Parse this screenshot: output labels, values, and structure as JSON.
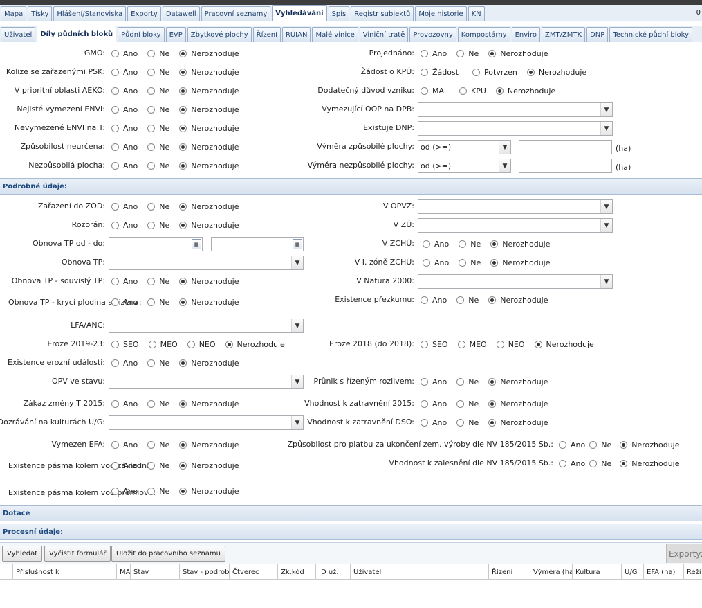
{
  "main_tabs": [
    "Mapa",
    "Tisky",
    "Hlášení/Stanoviska",
    "Exporty",
    "Datawell",
    "Pracovní seznamy",
    "Vyhledávání",
    "Spis",
    "Registr subjektů",
    "Moje historie",
    "KN"
  ],
  "main_tab_active": 6,
  "top_right_value": "0",
  "sub_tabs": [
    "Uživatel",
    "Díly půdních bloků",
    "Půdní bloky",
    "EVP",
    "Zbytkové plochy",
    "Řízení",
    "RÚIAN",
    "Malé vinice",
    "Viniční tratě",
    "Provozovny",
    "Kompostárny",
    "Enviro",
    "ZMT/ZMTK",
    "DNP",
    "Technické půdní bloky"
  ],
  "sub_tab_active": 1,
  "opt": {
    "ano": "Ano",
    "ne": "Ne",
    "nerozhoduje": "Nerozhoduje",
    "zadost": "Žádost",
    "potvrzen": "Potvrzen",
    "ma": "MA",
    "kpu": "KPU",
    "seo": "SEO",
    "meo": "MEO",
    "neo": "NEO"
  },
  "basic": {
    "gmo": "GMO:",
    "kolize": "Kolize se zařazenými PSK:",
    "prioritni": "V prioritní oblasti AEKO:",
    "nejiste": "Nejisté vymezení ENVI:",
    "nevymezene": "Nevymezené ENVI na T:",
    "zpusobilost": "Způsobilost neurčena:",
    "nezpusobila": "Nezpůsobilá plocha:",
    "projednano": "Projednáno:",
    "zadost_kpu": "Žádost o KPÚ:",
    "dodatecny": "Dodatečný důvod vzniku:",
    "vymezujici": "Vymezující OOP na DPB:",
    "existuje_dnp": "Existuje DNP:",
    "vymera_zp": "Výměra způsobilé plochy:",
    "vymera_nezp": "Výměra nezpůsobilé plochy:",
    "od_value": "od (>=)",
    "unit": "(ha)"
  },
  "sections": {
    "podrobne": "Podrobné údaje:",
    "dotace": "Dotace",
    "procesni": "Procesní údaje:"
  },
  "detail": {
    "zod": "Zařazení do ZOD:",
    "rozoran": "Rozorán:",
    "obnova_tp_od": "Obnova TP od - do:",
    "obnova_tp": "Obnova TP:",
    "obnova_souvisly": "Obnova TP - souvislý TP:",
    "obnova_kryci": "Obnova TP - krycí plodina sklizena:",
    "lfa": "LFA/ANC:",
    "eroze_2019": "Eroze 2019-23:",
    "existence_erozni": "Existence erozní události:",
    "opv": "OPV ve stavu:",
    "zakaz": "Zákaz změny T 2015:",
    "dozravani": "Dozrávání na kulturách U/G:",
    "efa": "Vymezen EFA:",
    "pasmo_zakladni": "Existence pásma kolem vod základní:",
    "pasmo_premiove": "Existence pásma kolem vod prémiové:",
    "v_opvz": "V OPVZ:",
    "v_zu": "V ZÚ:",
    "v_zchu": "V ZCHÚ:",
    "v_zona": "V I. zóně ZCHÚ:",
    "natura": "V Natura 2000:",
    "prezkum": "Existence přezkumu:",
    "eroze_2018": "Eroze 2018 (do 2018):",
    "prunik": "Průnik s řízeným rozlivem:",
    "vhodnost_2015": "Vhodnost k zatravnění 2015:",
    "vhodnost_dso": "Vhodnost k zatravnění DSO:",
    "zpusobilost_platba": "Způsobilost pro platbu za ukončení zem. výroby dle NV 185/2015 Sb.:",
    "zalesneni": "Vhodnost k zalesnění dle NV 185/2015 Sb.:"
  },
  "buttons": {
    "search": "Vyhledat",
    "clear": "Vyčistit formulář",
    "save": "Uložit do pracovního seznamu",
    "exports": "Exporty:"
  },
  "columns": [
    "Příslušnost k",
    "MA",
    "Stav",
    "Stav - podrobn",
    "Čtverec",
    "Zk.kód",
    "ID už.",
    "Uživatel",
    "Řízení",
    "Výměra (ha)",
    "Kultura",
    "U/G",
    "EFA (ha)",
    "Reži"
  ]
}
